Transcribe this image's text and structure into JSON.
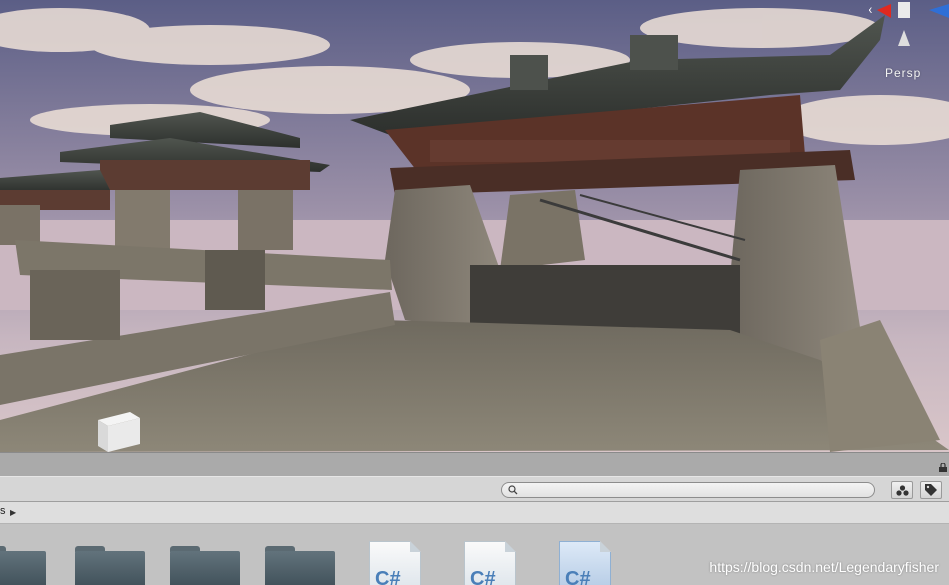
{
  "scene_view": {
    "projection_label": "Persp",
    "gizmo_axis_x": "x",
    "colors": {
      "x_axis": "#e0291f",
      "y_axis": "#7fbf3a",
      "z_axis": "#2f6fd6"
    }
  },
  "project_panel": {
    "breadcrumb": "s",
    "search": {
      "value": "",
      "placeholder": ""
    },
    "toolbar_icons": [
      "filter-by-type-icon",
      "filter-by-label-icon"
    ],
    "assets": [
      {
        "kind": "folder",
        "label": ""
      },
      {
        "kind": "folder",
        "label": ""
      },
      {
        "kind": "folder",
        "label": ""
      },
      {
        "kind": "folder",
        "label": ""
      },
      {
        "kind": "script",
        "glyph": "C#"
      },
      {
        "kind": "script",
        "glyph": "C#"
      },
      {
        "kind": "script",
        "glyph": "C#",
        "selected": true
      }
    ]
  },
  "watermark": "https://blog.csdn.net/Legendaryfisher"
}
